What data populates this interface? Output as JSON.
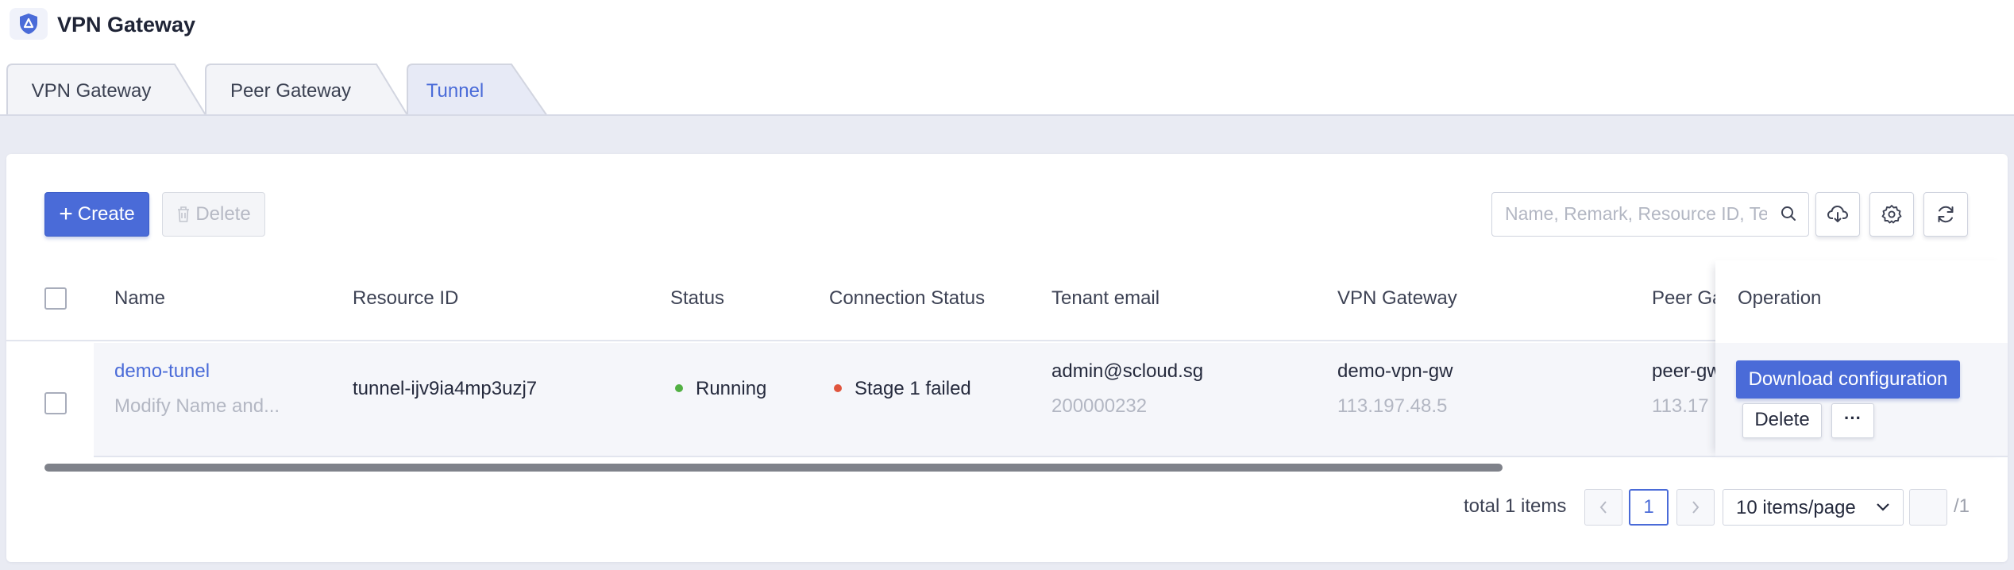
{
  "app": {
    "title": "VPN Gateway",
    "logo_icon": "shield-icon"
  },
  "tabs": [
    {
      "label": "VPN Gateway",
      "active": false
    },
    {
      "label": "Peer Gateway",
      "active": false
    },
    {
      "label": "Tunnel",
      "active": true
    }
  ],
  "toolbar": {
    "create_label": "Create",
    "delete_label": "Delete",
    "search_placeholder": "Name, Remark, Resource ID, Tenant email",
    "download_icon": "cloud-download-icon",
    "settings_icon": "gear-icon",
    "refresh_icon": "refresh-icon"
  },
  "table": {
    "columns": {
      "name": "Name",
      "resource_id": "Resource ID",
      "status": "Status",
      "connection_status": "Connection Status",
      "tenant_email": "Tenant email",
      "vpn_gateway": "VPN Gateway",
      "peer_gateway": "Peer Gateway",
      "operation": "Operation"
    },
    "rows": [
      {
        "name": "demo-tunel",
        "remark": "Modify Name and...",
        "resource_id": "tunnel-ijv9ia4mp3uzj7",
        "status": "Running",
        "status_color": "#52b043",
        "connection_status": "Stage 1 failed",
        "connection_color": "#e0553d",
        "tenant_email": "admin@scloud.sg",
        "tenant_id": "200000232",
        "vpn_gateway": "demo-vpn-gw",
        "vpn_gateway_ip": "113.197.48.5",
        "peer_gateway": "peer-gw",
        "peer_gateway_ip": "113.17",
        "ops": {
          "download": "Download configuration",
          "delete": "Delete",
          "more": "···"
        }
      }
    ]
  },
  "pagination": {
    "total_text": "total 1 items",
    "current_page": "1",
    "page_size": "10 items/page",
    "total_pages": "/1"
  },
  "colors": {
    "accent": "#4a6bd8",
    "background": "#e9ebf3"
  }
}
